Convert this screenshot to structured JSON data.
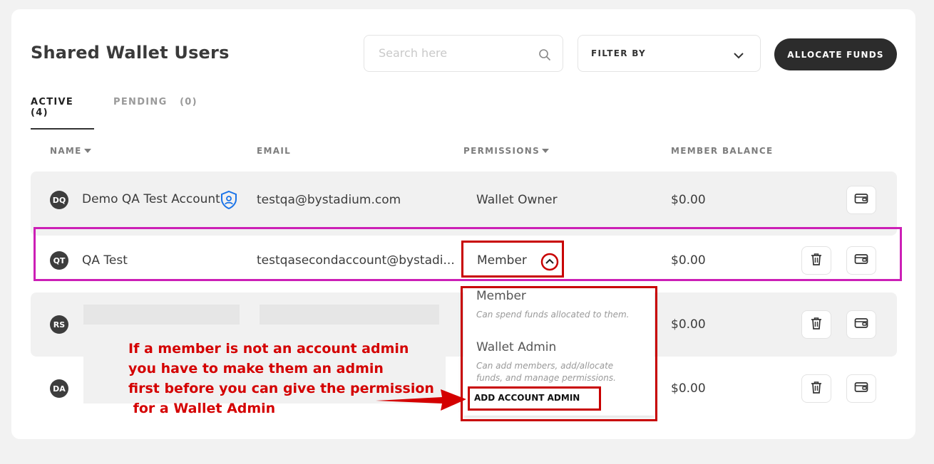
{
  "page": {
    "title": "Shared Wallet Users"
  },
  "search": {
    "placeholder": "Search here"
  },
  "filter": {
    "label": "FILTER BY"
  },
  "allocate_button": "ALLOCATE FUNDS",
  "tabs": [
    {
      "label": "ACTIVE",
      "count": "(4)"
    },
    {
      "label": "PENDING",
      "count": "(0)"
    }
  ],
  "columns": {
    "name": "NAME",
    "email": "EMAIL",
    "permissions": "PERMISSIONS",
    "balance": "MEMBER BALANCE"
  },
  "rows": [
    {
      "initials": "DQ",
      "name": "Demo QA Test Account",
      "email": "testqa@bystadium.com",
      "permission": "Wallet Owner",
      "balance": "$0.00"
    },
    {
      "initials": "QT",
      "name": "QA Test",
      "email": "testqasecondaccount@bystadi...",
      "permission": "Member",
      "balance": "$0.00"
    },
    {
      "initials": "RS",
      "balance": "$0.00"
    },
    {
      "initials": "DA",
      "balance": "$0.00"
    }
  ],
  "permission_dropdown": {
    "options": [
      {
        "title": "Member",
        "description": "Can spend funds allocated to them."
      },
      {
        "title": "Wallet Admin",
        "description_line1": "Can add members, add/allocate",
        "description_line2": "funds, and manage permissions."
      }
    ],
    "action": "ADD ACCOUNT ADMIN"
  },
  "annotation": {
    "line1": "If a member is not an account admin",
    "line2": "you have to make them an admin",
    "line3": "first before you can give the permission",
    "line4": " for a Wallet Admin"
  },
  "colors": {
    "highlight_row": "#cc1fb6",
    "annotation": "#d40000",
    "primary_button": "#2c2c2c",
    "owner_badge": "#1a73e8"
  },
  "icons": [
    "search-icon",
    "chevron-down-icon",
    "chevron-up-icon",
    "shield-user-icon",
    "trash-icon",
    "wallet-icon",
    "arrow-icon"
  ]
}
